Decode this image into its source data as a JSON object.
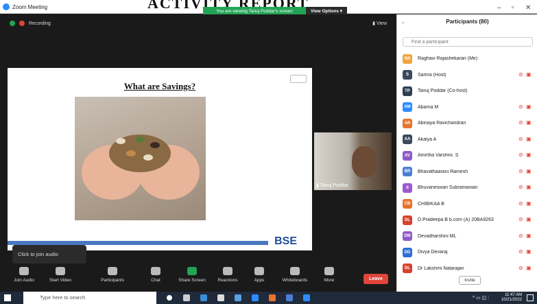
{
  "window": {
    "title": "Zoom Meeting",
    "overlay_title": "ACTIVITY REPORT",
    "viewing_banner": "You are viewing Tanuj Poddar's screen",
    "view_options": "View Options ▾",
    "min": "–",
    "max": "▫",
    "close": "✕"
  },
  "meeting": {
    "recording_label": "Recording",
    "view_label": "View",
    "slide_title": "What are Savings?",
    "slide_logo_text": "BSE",
    "video_name": "Tanuj Poddar",
    "join_audio_tip": "Click to join audio"
  },
  "toolbar": {
    "join_audio": "Join Audio",
    "start_video": "Start Video",
    "participants": "Participants",
    "participants_count": "80",
    "chat": "Chat",
    "share_screen": "Share Screen",
    "reactions": "Reactions",
    "apps": "Apps",
    "whiteboards": "Whiteboards",
    "more": "More",
    "leave": "Leave"
  },
  "panel": {
    "title": "Participants (80)",
    "search_placeholder": "Find a participant",
    "invite": "Invite",
    "participants": [
      {
        "initials": "RR",
        "name": "Raghavi Rajashekaran (Me)",
        "color": "#f0a33c",
        "muted": false
      },
      {
        "initials": "S",
        "name": "Samra (Host)",
        "color": "#3a4a5c",
        "muted": true
      },
      {
        "initials": "TP",
        "name": "Tanuj Poddar (Co-host)",
        "color": "#2d3e52",
        "muted": false
      },
      {
        "initials": "AM",
        "name": "Abarna M",
        "color": "#2d8cff",
        "muted": true
      },
      {
        "initials": "AR",
        "name": "Abinaya Ravichandran",
        "color": "#e8732e",
        "muted": true
      },
      {
        "initials": "AA",
        "name": "Akalya A",
        "color": "#3a4a5c",
        "muted": true
      },
      {
        "initials": "AV",
        "name": "Amirtha Varshini. S",
        "color": "#8e5cc8",
        "muted": true
      },
      {
        "initials": "BR",
        "name": "Bhavathaarani Ramesh",
        "color": "#4a7fd6",
        "muted": true
      },
      {
        "initials": "S",
        "name": "Bhuvaneswari Subramanian",
        "color": "#9b59d0",
        "muted": true
      },
      {
        "initials": "CB",
        "name": "CHIBIKAA B",
        "color": "#e8732e",
        "muted": true
      },
      {
        "initials": "DL",
        "name": "D.Pradeepa B b.com (A) 20BA9263",
        "color": "#d9412f",
        "muted": true
      },
      {
        "initials": "DM",
        "name": "Devadharshini ML",
        "color": "#8e5cc8",
        "muted": true
      },
      {
        "initials": "DD",
        "name": "Divya Devaraj",
        "color": "#2d6fd6",
        "muted": true
      },
      {
        "initials": "DL",
        "name": "Dr Lakshmi Natarajan",
        "color": "#d9412f",
        "muted": true
      }
    ]
  },
  "taskbar": {
    "search_placeholder": "Type here to search",
    "time": "11:47 AM",
    "date": "10/21/2022"
  }
}
